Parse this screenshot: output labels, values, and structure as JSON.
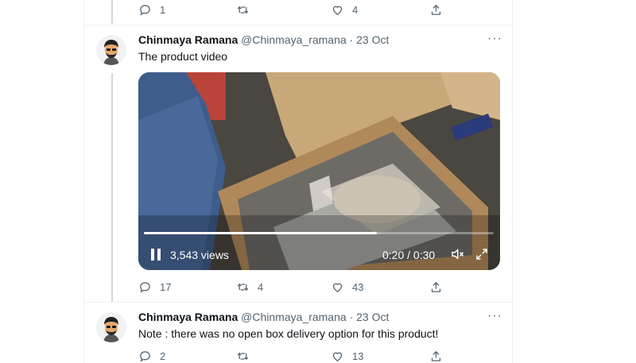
{
  "prev_tweet": {
    "replies": "1",
    "retweets": "",
    "likes": "4"
  },
  "tweet1": {
    "name": "Chinmaya Ramana",
    "handle": "@Chinmaya_ramana",
    "separator": "·",
    "date": "23 Oct",
    "text": "The product video",
    "video": {
      "views": "3,543 views",
      "time": "0:20 / 0:30",
      "progress": 0.667
    },
    "replies": "17",
    "retweets": "4",
    "likes": "43"
  },
  "tweet2": {
    "name": "Chinmaya Ramana",
    "handle": "@Chinmaya_ramana",
    "separator": "·",
    "date": "23 Oct",
    "text": "Note : there was no open box delivery option for this product!",
    "replies": "2",
    "retweets": "",
    "likes": "13"
  },
  "colors": {
    "text": "#0f1419",
    "secondary": "#536471",
    "divider": "#eff3f4"
  },
  "icons": [
    "reply-icon",
    "retweet-icon",
    "like-icon",
    "share-icon",
    "more-icon",
    "pause-icon",
    "volume-icon",
    "fullscreen-icon",
    "avatar-icon"
  ]
}
